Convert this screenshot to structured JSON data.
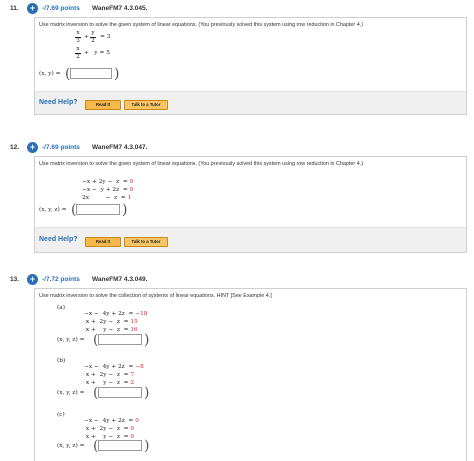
{
  "q11": {
    "number": "11.",
    "plus": "+",
    "points": "-/7.69 points",
    "code": "WaneFM7 4.3.045.",
    "prompt": "Use matrix inversion to solve the given system of linear equations. (You previously solved this system using row reduction in Chapter 4.)",
    "eq1_frac1_num": "x",
    "eq1_frac1_den": "3",
    "eq1_plus": "+",
    "eq1_frac2_num": "y",
    "eq1_frac2_den": "2",
    "eq1_rhs": "= 3",
    "eq2_frac_num": "x",
    "eq2_frac_den": "2",
    "eq2_rest": "+   y = 5",
    "answer_label": "(x, y) =",
    "open_paren": "(",
    "close_paren": ")",
    "need_help": "Need Help?",
    "read_it": "Read It",
    "talk_tutor": "Talk to a Tutor"
  },
  "q12": {
    "number": "12.",
    "plus": "+",
    "points": "-/7.69 points",
    "code": "WaneFM7 4.3.047.",
    "prompt": "Use matrix inversion to solve the given system of linear equations. (You previously solved this system using row reduction in Chapter 4.)",
    "eqs": [
      {
        "lhs": "−x + 2y −  z  = ",
        "rhs": "0"
      },
      {
        "lhs": "−x −  y + 2z  = ",
        "rhs": "0"
      },
      {
        "lhs": "2x         −  z  = ",
        "rhs": "1"
      }
    ],
    "answer_label": "(x, y, z) =",
    "open_paren": "(",
    "close_paren": ")",
    "need_help": "Need Help?",
    "read_it": "Read It",
    "talk_tutor": "Talk to a Tutor"
  },
  "q13": {
    "number": "13.",
    "plus": "+",
    "points": "-/7.72 points",
    "code": "WaneFM7 4.3.049.",
    "prompt": "Use matrix inversion to solve the collection of systems of linear equations. HINT [See Example 4.]",
    "parts": [
      {
        "label": "(a)",
        "eqs": [
          {
            "lhs": "−x −  4y + 2z  = ",
            "rhs": "−18"
          },
          {
            "lhs": " x +  2y −  z  = ",
            "rhs": "15"
          },
          {
            "lhs": " x +    y −  z  = ",
            "rhs": "16"
          }
        ],
        "answer_label": "(x, y, z) ="
      },
      {
        "label": "(b)",
        "eqs": [
          {
            "lhs": "−x −  4y + 2z  = ",
            "rhs": "−8"
          },
          {
            "lhs": " x +  2y −  z  = ",
            "rhs": "7"
          },
          {
            "lhs": " x +    y −  z  = ",
            "rhs": "2"
          }
        ],
        "answer_label": "(x, y, z) ="
      },
      {
        "label": "(c)",
        "eqs": [
          {
            "lhs": "−x −  4y + 2z  = ",
            "rhs": "0"
          },
          {
            "lhs": " x +  2y −  z  = ",
            "rhs": "0"
          },
          {
            "lhs": " x +    y −  z  = ",
            "rhs": "0"
          }
        ],
        "answer_label": "(x, y, z) ="
      }
    ],
    "open_paren": "(",
    "close_paren": ")"
  },
  "colors": {
    "accent": "#2a6fb5",
    "red": "#d02020",
    "button": "#f6b84a"
  }
}
